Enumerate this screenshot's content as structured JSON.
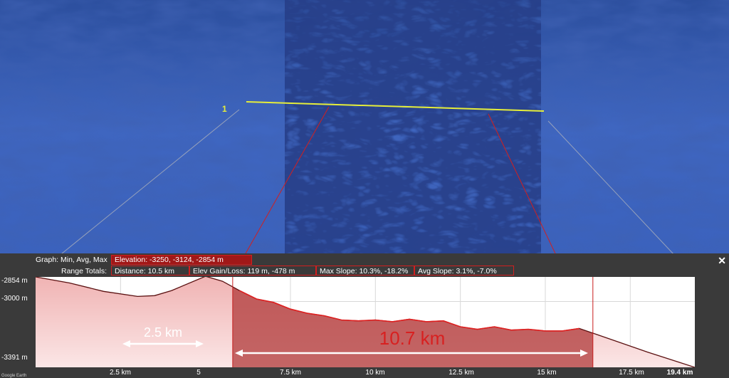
{
  "marker_label": "1",
  "graph": {
    "mode_label": "Graph: Min, Avg, Max",
    "elevation_label": "Elevation:",
    "elevation_values": "-3250, -3124, -2854 m",
    "range_totals_label": "Range Totals:",
    "distance": "Distance: 10.5 km",
    "elev_gain_loss": "Elev Gain/Loss: 119 m, -478 m",
    "max_slope": "Max Slope: 10.3%, -18.2%",
    "avg_slope": "Avg Slope: 3.1%, -7.0%",
    "close_icon": "close-icon"
  },
  "y_axis": {
    "labels": [
      "-2854 m",
      "-3000 m",
      "-3391 m"
    ]
  },
  "x_axis": {
    "labels": [
      "2.5 km",
      "5",
      "7.5 km",
      "10 km",
      "12.5 km",
      "15 km",
      "17.5 km",
      "19.4 km"
    ]
  },
  "annotations": {
    "left_span": "2.5 km",
    "selected_span": "10.7 km"
  },
  "logo": "Google Earth",
  "colors": {
    "selection": "#c81e1e",
    "profile_fill": "#f5c9c9",
    "path_line": "#e6ee3a"
  },
  "chart_data": {
    "type": "area",
    "title": "",
    "xlabel": "",
    "ylabel": "",
    "xlim": [
      0,
      19.4
    ],
    "ylim": [
      -3391,
      -2854
    ],
    "x": [
      0,
      1,
      2,
      3,
      3.5,
      4,
      5,
      5.5,
      6,
      6.5,
      7,
      7.5,
      8,
      8.5,
      9,
      9.5,
      10,
      10.5,
      11,
      11.5,
      12,
      12.5,
      13,
      13.5,
      14,
      14.5,
      15,
      15.5,
      16,
      16.5,
      17,
      18,
      19.4
    ],
    "y": [
      -2854,
      -2890,
      -2940,
      -2970,
      -2965,
      -2935,
      -2850,
      -2880,
      -2935,
      -2985,
      -3005,
      -3045,
      -3070,
      -3085,
      -3110,
      -3115,
      -3110,
      -3120,
      -3105,
      -3120,
      -3115,
      -3150,
      -3165,
      -3150,
      -3170,
      -3165,
      -3175,
      -3175,
      -3160,
      -3195,
      -3230,
      -3300,
      -3391
    ],
    "selection": {
      "start": 5.8,
      "end": 16.4
    }
  }
}
